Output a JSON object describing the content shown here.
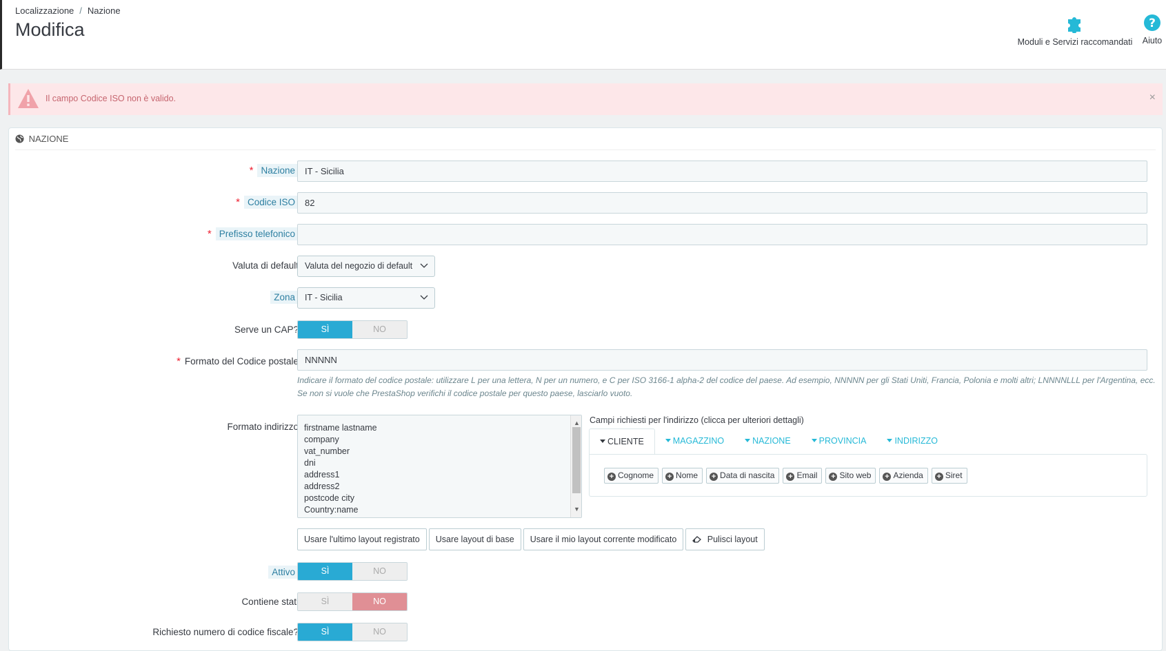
{
  "header": {
    "breadcrumb": [
      "Localizzazione",
      "Nazione"
    ],
    "title": "Modifica",
    "toolbar": {
      "modules_label": "Moduli e Servizi raccomandati",
      "help_label": "Aiuto"
    }
  },
  "alert": {
    "message": "Il campo Codice ISO non è valido.",
    "close": "×"
  },
  "panel": {
    "title": "NAZIONE",
    "fields": {
      "country_label": "Nazione",
      "country_value": "IT - Sicilia",
      "iso_label": "Codice ISO",
      "iso_value": "82",
      "phone_label": "Prefisso telefonico",
      "phone_value": "",
      "currency_label": "Valuta di default",
      "currency_value": "Valuta del negozio di default",
      "zone_label": "Zona",
      "zone_value": "IT - Sicilia",
      "zip_needed_label": "Serve un CAP?",
      "zip_format_label": "Formato del Codice postale",
      "zip_format_value": "NNNNN",
      "zip_help": "Indicare il formato del codice postale: utilizzare L per una lettera, N per un numero, e C per ISO 3166-1 alpha-2 del codice del paese. Ad esempio, NNNNN per gli Stati Uniti, Francia, Polonia e molti altri; LNNNNLLL per l'Argentina, ecc. Se non si vuole che PrestaShop verifichi il codice postale per questo paese, lasciarlo vuoto.",
      "address_format_label": "Formato indirizzo",
      "address_lines": [
        "firstname lastname",
        "company",
        "vat_number",
        "dni",
        "address1",
        "address2",
        "postcode city",
        "Country:name"
      ],
      "active_label": "Attivo",
      "contains_states_label": "Contiene stati",
      "tax_id_label": "Richiesto numero di codice fiscale?"
    },
    "switch": {
      "yes": "SÌ",
      "no": "NO"
    },
    "required_mark": "*",
    "address_fields": {
      "caption": "Campi richiesti per l'indirizzo (clicca per ulteriori dettagli)",
      "tabs": [
        "CLIENTE",
        "MAGAZZINO",
        "NAZIONE",
        "PROVINCIA",
        "INDIRIZZO"
      ],
      "chips": [
        "Cognome",
        "Nome",
        "Data di nascita",
        "Email",
        "Sito web",
        "Azienda",
        "Siret"
      ]
    },
    "layout_buttons": {
      "last": "Usare l'ultimo layout registrato",
      "default": "Usare layout di base",
      "current": "Usare il mio layout corrente modificato",
      "clear": "Pulisci layout"
    }
  },
  "colors": {
    "accent": "#25b9d7",
    "switch_on": "#29aad4",
    "danger": "#e08f95",
    "alert_bg": "#fde7e9"
  },
  "icons": {
    "modules": "puzzle-icon",
    "help": "question-circle-icon",
    "alert": "warning-triangle-icon",
    "panel": "globe-icon"
  }
}
